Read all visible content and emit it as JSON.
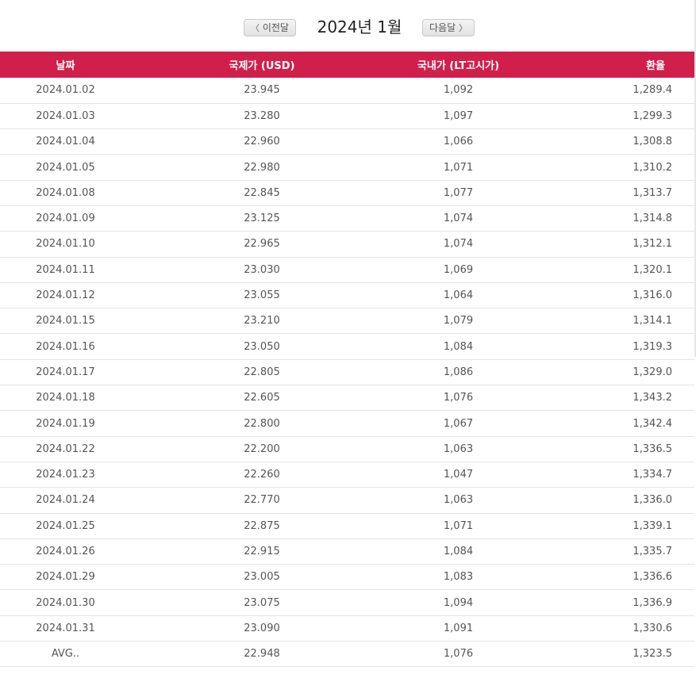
{
  "nav": {
    "prev_label": "이전달",
    "next_label": "다음달",
    "title": "2024년 1월"
  },
  "table": {
    "headers": {
      "date": "날짜",
      "international": "국제가 (USD)",
      "domestic": "국내가 (LT고시가)",
      "exchange": "환율"
    },
    "rows": [
      {
        "date": "2024.01.02",
        "intl": "23.945",
        "dom": "1,092",
        "fx": "1,289.4"
      },
      {
        "date": "2024.01.03",
        "intl": "23.280",
        "dom": "1,097",
        "fx": "1,299.3"
      },
      {
        "date": "2024.01.04",
        "intl": "22.960",
        "dom": "1,066",
        "fx": "1,308.8"
      },
      {
        "date": "2024.01.05",
        "intl": "22.980",
        "dom": "1,071",
        "fx": "1,310.2"
      },
      {
        "date": "2024.01.08",
        "intl": "22.845",
        "dom": "1,077",
        "fx": "1,313.7"
      },
      {
        "date": "2024.01.09",
        "intl": "23.125",
        "dom": "1,074",
        "fx": "1,314.8"
      },
      {
        "date": "2024.01.10",
        "intl": "22.965",
        "dom": "1,074",
        "fx": "1,312.1"
      },
      {
        "date": "2024.01.11",
        "intl": "23.030",
        "dom": "1,069",
        "fx": "1,320.1"
      },
      {
        "date": "2024.01.12",
        "intl": "23.055",
        "dom": "1,064",
        "fx": "1,316.0"
      },
      {
        "date": "2024.01.15",
        "intl": "23.210",
        "dom": "1,079",
        "fx": "1,314.1"
      },
      {
        "date": "2024.01.16",
        "intl": "23.050",
        "dom": "1,084",
        "fx": "1,319.3"
      },
      {
        "date": "2024.01.17",
        "intl": "22.805",
        "dom": "1,086",
        "fx": "1,329.0"
      },
      {
        "date": "2024.01.18",
        "intl": "22.605",
        "dom": "1,076",
        "fx": "1,343.2"
      },
      {
        "date": "2024.01.19",
        "intl": "22.800",
        "dom": "1,067",
        "fx": "1,342.4"
      },
      {
        "date": "2024.01.22",
        "intl": "22.200",
        "dom": "1,063",
        "fx": "1,336.5"
      },
      {
        "date": "2024.01.23",
        "intl": "22.260",
        "dom": "1,047",
        "fx": "1,334.7"
      },
      {
        "date": "2024.01.24",
        "intl": "22.770",
        "dom": "1,063",
        "fx": "1,336.0"
      },
      {
        "date": "2024.01.25",
        "intl": "22.875",
        "dom": "1,071",
        "fx": "1,339.1"
      },
      {
        "date": "2024.01.26",
        "intl": "22.915",
        "dom": "1,084",
        "fx": "1,335.7"
      },
      {
        "date": "2024.01.29",
        "intl": "23.005",
        "dom": "1,083",
        "fx": "1,336.6"
      },
      {
        "date": "2024.01.30",
        "intl": "23.075",
        "dom": "1,094",
        "fx": "1,336.9"
      },
      {
        "date": "2024.01.31",
        "intl": "23.090",
        "dom": "1,091",
        "fx": "1,330.6"
      },
      {
        "date": "AVG..",
        "intl": "22.948",
        "dom": "1,076",
        "fx": "1,323.5"
      }
    ]
  },
  "colors": {
    "header_bg": "#d11f4b",
    "header_text": "#ffffff",
    "row_border": "#e4e4e4"
  },
  "icons": {
    "prev": "chevron-left-icon",
    "next": "chevron-right-icon"
  }
}
